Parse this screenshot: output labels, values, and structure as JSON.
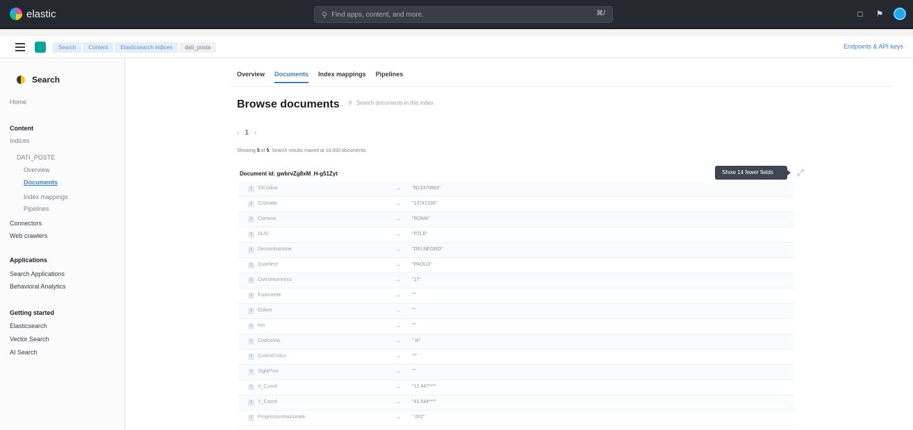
{
  "app": {
    "brand": "elastic"
  },
  "header": {
    "search_placeholder": "Find apps, content, and more.",
    "search_shortcut": "⌘/"
  },
  "breadcrumbs": [
    "Search",
    "Content",
    "Elasticsearch indices",
    "dati_posta"
  ],
  "endpoints_label": "Endpoints & API keys",
  "sidebar": {
    "title": "Search",
    "home": "Home",
    "content_group": "Content",
    "indices": "Indices",
    "index_name": "DATI_POSTE",
    "sub_items": [
      "Overview",
      "Documents",
      "Index mappings",
      "Pipelines"
    ],
    "connectors": "Connectors",
    "web_crawlers": "Web crawlers",
    "applications_group": "Applications",
    "search_applications": "Search Applications",
    "behavioral_analytics": "Behavioral Analytics",
    "getting_started_group": "Getting started",
    "elasticsearch": "Elasticsearch",
    "vector_search": "Vector Search",
    "ai_search": "AI Search"
  },
  "tabs": [
    "Overview",
    "Documents",
    "Index mappings",
    "Pipelines"
  ],
  "browse": {
    "title": "Browse documents",
    "search_placeholder": "Search documents in this index",
    "page": "1",
    "showing_prefix": "Showing",
    "showing_count": "5",
    "showing_middle": "of",
    "showing_total": "5",
    "showing_suffix": "Search results maxed at 10,000 documents."
  },
  "document": {
    "id_label": "Document id: gwbrvZg8xM_H-g51Zyt",
    "tooltip": "Show 14 fewer fields",
    "fields": [
      {
        "name": "IDCodice",
        "value": "\"N13370883\""
      },
      {
        "name": "IDStrada",
        "value": "\"13741335\""
      },
      {
        "name": "Comune",
        "value": "\"ROMA\""
      },
      {
        "name": "DUG",
        "value": "\"PZLE\""
      },
      {
        "name": "Denominazione",
        "value": "\"DELNEGRO\""
      },
      {
        "name": "Quartiere",
        "value": "\"PAOLO\""
      },
      {
        "name": "CivicoNumerico",
        "value": "\"17\""
      },
      {
        "name": "Esponente",
        "value": "\"\""
      },
      {
        "name": "Colore",
        "value": "\"\""
      },
      {
        "name": "Km",
        "value": "\"\""
      },
      {
        "name": "CodiceVia",
        "value": "\"   N\""
      },
      {
        "name": "CodiceCivico",
        "value": "\"*\""
      },
      {
        "name": "SiglaProv",
        "value": "\"\""
      },
      {
        "name": "X_Coord",
        "value": "\"12.447***\""
      },
      {
        "name": "Y_Coord",
        "value": "\"41.544***\""
      },
      {
        "name": "ProgressivoNazionale",
        "value": "\"  002\""
      }
    ]
  }
}
